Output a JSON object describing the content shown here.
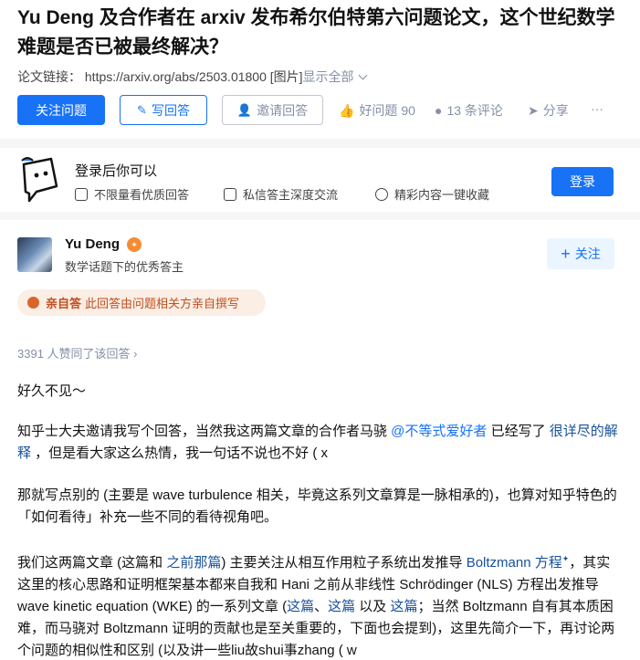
{
  "question": {
    "title": "Yu Deng 及合作者在 arxiv 发布希尔伯特第六问题论文，这个世纪数学难题是否已被最终解决？",
    "link_label": "论文链接：",
    "link_url": "https://arxiv.org/abs/2503.01800",
    "image_tag": "[图片]",
    "show_all": "显示全部",
    "buttons": {
      "follow": "关注问题",
      "write_answer": "写回答",
      "invite": "邀请回答"
    },
    "actions": {
      "good_question": "好问题 90",
      "comments": "13 条评论",
      "share": "分享",
      "more": "···"
    }
  },
  "login_prompt": {
    "title": "登录后你可以",
    "features": [
      "不限量看优质回答",
      "私信答主深度交流",
      "精彩内容一键收藏"
    ],
    "login_button": "登录"
  },
  "answer": {
    "author_name": "Yu Deng",
    "author_badge": "✦",
    "author_desc": "数学话题下的优秀答主",
    "follow_button": "关注",
    "self_answer_tag": "亲自答",
    "self_answer_text": "此回答由问题相关方亲自撰写",
    "upvote_text": "3391 人赞同了该回答 ›",
    "p1": "好久不见～",
    "p2a": "知乎士大夫邀请我写个回答，当然我这两篇文章的合作者马骁 ",
    "p2_mention": "@不等式爱好者",
    "p2b": " 已经写了 ",
    "p2_link": "很详尽的解释",
    "p2c": " ，但是看大家这么热情，我一句话不说也不好 ( x",
    "p3": "那就写点别的 (主要是 wave turbulence 相关，毕竟这系列文章算是一脉相承的)，也算对知乎特色的「如何看待」补充一些不同的看待视角吧。",
    "p4a": "我们这两篇文章 (这篇和 ",
    "p4_link1": "之前那篇",
    "p4b": ") 主要关注从相互作用粒子系统出发推导 ",
    "p4_link2": "Boltzmann 方程",
    "p4_link2_mark": "✦",
    "p4c": "，其实这里的核心思路和证明框架基本都来自我和 Hani 之前从非线性 Schrödinger (NLS) 方程出发推导 wave kinetic equation (WKE) 的一系列文章 (",
    "p4_link3": "这篇",
    "p4_sep": "、",
    "p4_link4": "这篇",
    "p4d": " 以及 ",
    "p4_link5": "这篇",
    "p4e": "；当然 Boltzmann 自有其本质困难，而马骁对 Boltzmann 证明的贡献也是至关重要的，下面也会提到)，这里先简介一下，再讨论两个问题的相似性和区别 (以及讲一些liu故shui事zhang ( w"
  },
  "colors": {
    "brand_blue": "#1772f6",
    "link_blue": "#175199",
    "muted": "#8590a6",
    "self_tag_bg": "#fbeee5",
    "self_tag_text": "#c14f1e",
    "badge_orange": "#f68b32"
  },
  "icons": {
    "pen": "pen-icon",
    "invite": "invite-user-icon",
    "thumb": "thumb-up-icon",
    "comment": "comment-icon",
    "share": "paper-plane-icon",
    "more": "ellipsis-icon",
    "chevron": "chevron-down-icon",
    "copy": "copy-icon",
    "message": "message-icon",
    "favorite": "favorite-icon"
  }
}
